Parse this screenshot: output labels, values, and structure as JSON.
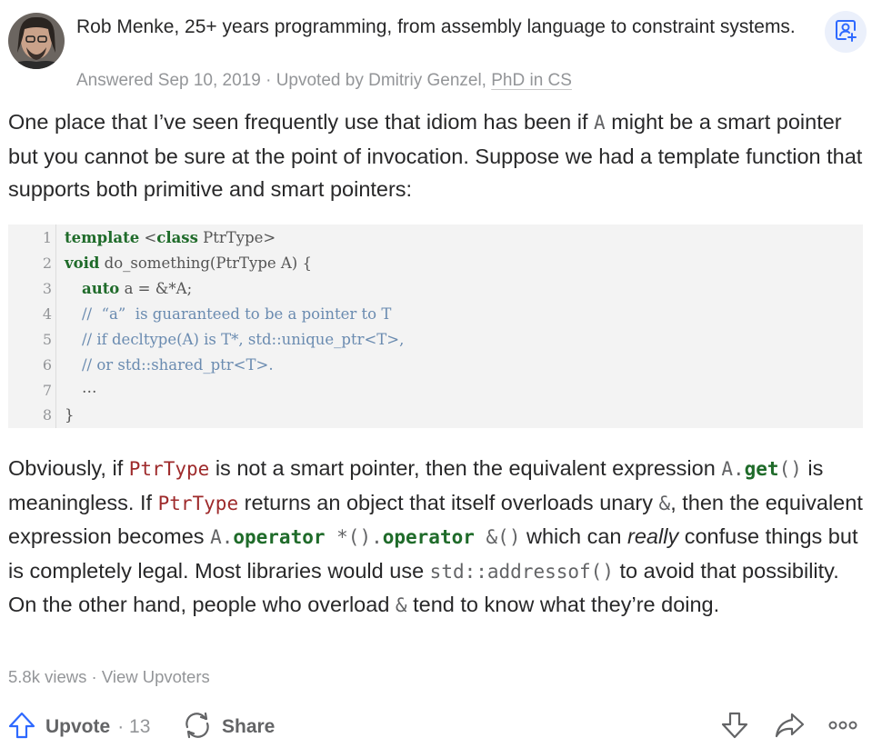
{
  "answer": {
    "author_line": "Rob Menke, 25+ years programming, from assembly language to constraint systems.",
    "answered": "Answered Sep 10, 2019",
    "sep": "·",
    "upvoted_by": "Upvoted by Dmitriy Genzel,",
    "upvoter_credential": "PhD in CS",
    "para1": {
      "t1": "One place that I’ve seen frequently use that idiom has been if ",
      "c1": "A",
      "t2": " might be a smart pointer but you cannot be sure at the point of invocation. Suppose we had a template function that supports both primitive and smart pointers:"
    },
    "code": {
      "line_numbers": [
        "1",
        "2",
        "3",
        "4",
        "5",
        "6",
        "7",
        "8"
      ],
      "lines": [
        {
          "kw": "template",
          "rest1": " <",
          "kw2": "class",
          "rest2": " PtrType>"
        },
        {
          "kw": "void",
          "rest1": " do_something(PtrType A) {"
        },
        {
          "kw": "auto",
          "rest1": " a = &*A;"
        },
        {
          "comment": "//  “a”  is guaranteed to be a pointer to T"
        },
        {
          "comment": "// if decltype(A) is T*, std::unique_ptr<T>,"
        },
        {
          "comment": "// or std::shared_ptr<T>."
        },
        {
          "rest1": "…"
        },
        {
          "rest1": "}"
        }
      ]
    },
    "para2": {
      "t1": "Obviously, if ",
      "c1": "PtrType",
      "t2": " is not a smart pointer, then the equivalent expression ",
      "c2a": "A.",
      "c2b": "get",
      "c2c": "()",
      "t3": " is meaningless. If ",
      "c3": "PtrType",
      "t4": " returns an object that itself overloads unary ",
      "c4": "&",
      "t5": ", then the equivalent expression becomes ",
      "c5a": "A.",
      "c5b": "operator",
      "c5c": " *().",
      "c5d": "operator",
      "c5e": " &()",
      "t6": " which can ",
      "em": "really",
      "t7": " confuse things but is completely legal. Most libraries would use ",
      "c6": "std::addressof()",
      "t8": " to avoid that possibility. On the other hand, people who overload ",
      "c7": "&",
      "t9": " tend to know what they’re doing."
    },
    "views": "5.8k views",
    "view_upvoters": "View Upvoters",
    "upvote_label": "Upvote",
    "upvote_count": "· 13",
    "share_label": "Share"
  },
  "icons": {
    "follow": "person-plus-icon",
    "upvote": "upvote-arrow-icon",
    "share": "share-cycle-icon",
    "downvote": "downvote-arrow-icon",
    "reshare": "forward-arrow-icon",
    "more": "more-dots-icon"
  },
  "colors": {
    "accent": "#2e69ff",
    "follow_bg": "#ebf0fb",
    "code_keyword": "#1f6b2a",
    "code_comment": "#6a8bb0",
    "code_type": "#9e2a2b"
  }
}
